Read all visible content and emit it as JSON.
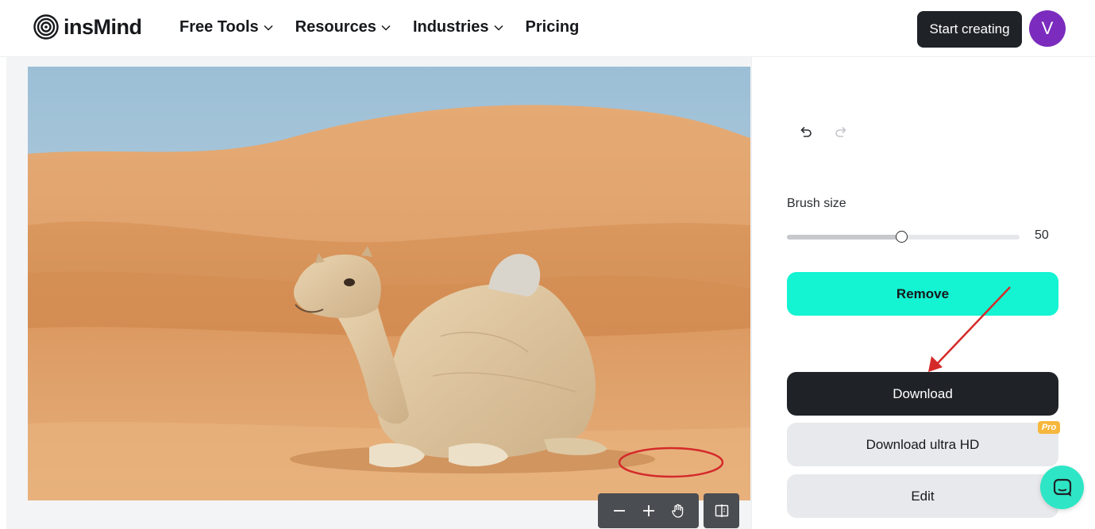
{
  "header": {
    "brand": "insMind",
    "nav": [
      {
        "label": "Free Tools",
        "has_dropdown": true
      },
      {
        "label": "Resources",
        "has_dropdown": true
      },
      {
        "label": "Industries",
        "has_dropdown": true
      },
      {
        "label": "Pricing",
        "has_dropdown": false
      }
    ],
    "cta_label": "Start creating",
    "avatar_initial": "V",
    "avatar_color": "#7b2bbd"
  },
  "editor": {
    "image_subject": "camel-in-desert",
    "canvas_tools": [
      "zoom-out-icon",
      "zoom-in-icon",
      "hand-icon"
    ],
    "compare_icon": "compare-icon"
  },
  "panel": {
    "brush_size_label": "Brush size",
    "brush_size_value": "50",
    "brush_size_fraction": 0.49,
    "remove_label": "Remove",
    "download_label": "Download",
    "download_hd_label": "Download ultra HD",
    "pro_badge": "Pro",
    "edit_label": "Edit"
  },
  "colors": {
    "accent": "#14f3d2",
    "dark": "#1f2328",
    "pro": "#f6b73c",
    "annotation": "#d42a2a"
  }
}
